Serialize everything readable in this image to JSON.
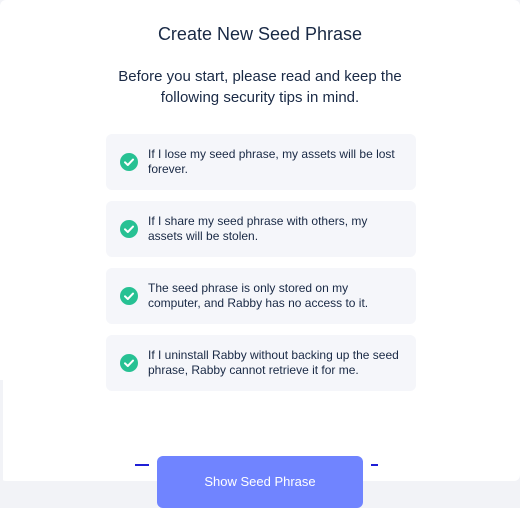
{
  "header": {
    "title": "Create New Seed Phrase",
    "subtitle": "Before you start, please read and keep the following security tips in mind."
  },
  "tips": [
    {
      "text": "If I lose my seed phrase, my assets will be lost forever.",
      "icon": "check-circle-icon"
    },
    {
      "text": "If I share my seed phrase with others, my assets will be stolen.",
      "icon": "check-circle-icon"
    },
    {
      "text": "The seed phrase is only stored on my computer, and Rabby has no access to it.",
      "icon": "check-circle-icon"
    },
    {
      "text": "If I uninstall Rabby without backing up the seed phrase, Rabby cannot retrieve it for me.",
      "icon": "check-circle-icon"
    }
  ],
  "footer": {
    "show_button_label": "Show Seed Phrase"
  },
  "colors": {
    "accent": "#7084ff",
    "check": "#27c193",
    "tip_background": "#f5f6fa"
  }
}
